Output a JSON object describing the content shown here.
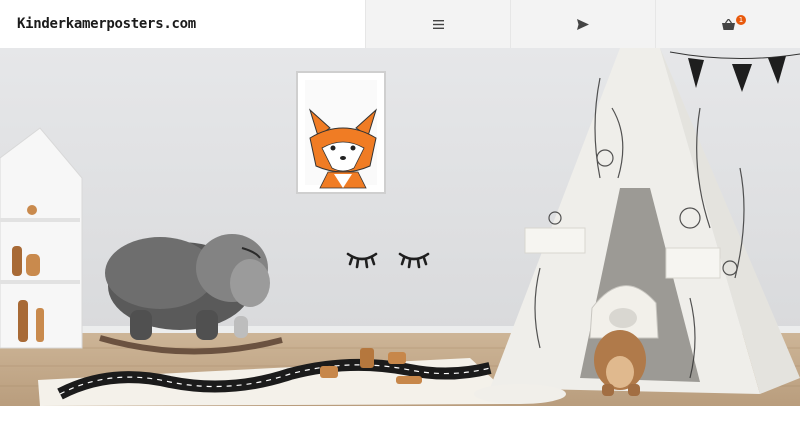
{
  "header": {
    "logo_text": "Kinderkamerposters.com",
    "menu_icon": "hamburger-menu-icon",
    "send_icon": "paper-plane-icon",
    "cart_icon": "shopping-basket-icon",
    "cart_count": "1"
  },
  "hero": {
    "image": "kids-room-with-fox-poster-and-teepee"
  },
  "colors": {
    "header_bg": "#f3f3f3",
    "badge": "#e8590c",
    "fox_orange": "#f07c24",
    "wall": "#dfe0e2",
    "floor": "#c4ab8d"
  }
}
